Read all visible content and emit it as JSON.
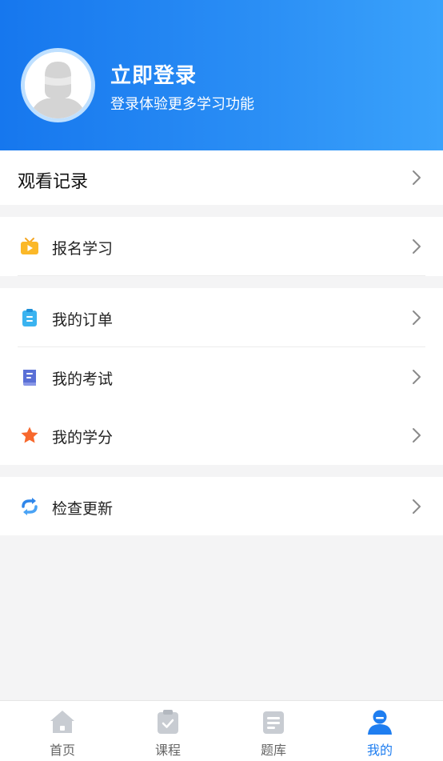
{
  "header": {
    "title": "立即登录",
    "subtitle": "登录体验更多学习功能"
  },
  "watch_history": {
    "label": "观看记录"
  },
  "menu": {
    "enroll": {
      "label": "报名学习",
      "icon": "tv-play-icon"
    },
    "orders": {
      "label": "我的订单",
      "icon": "clipboard-icon"
    },
    "exams": {
      "label": "我的考试",
      "icon": "book-icon"
    },
    "credits": {
      "label": "我的学分",
      "icon": "star-icon"
    },
    "update": {
      "label": "检查更新",
      "icon": "sync-icon"
    }
  },
  "bottom_nav": {
    "items": [
      {
        "label": "首页",
        "icon": "home-icon"
      },
      {
        "label": "课程",
        "icon": "course-icon"
      },
      {
        "label": "题库",
        "icon": "question-bank-icon"
      },
      {
        "label": "我的",
        "icon": "profile-icon"
      }
    ],
    "active_index": 3
  },
  "colors": {
    "header_start": "#1677ee",
    "header_end": "#3aa2fb",
    "active_nav": "#1f7ef0",
    "inactive_nav_icon": "#c8ccd2"
  }
}
